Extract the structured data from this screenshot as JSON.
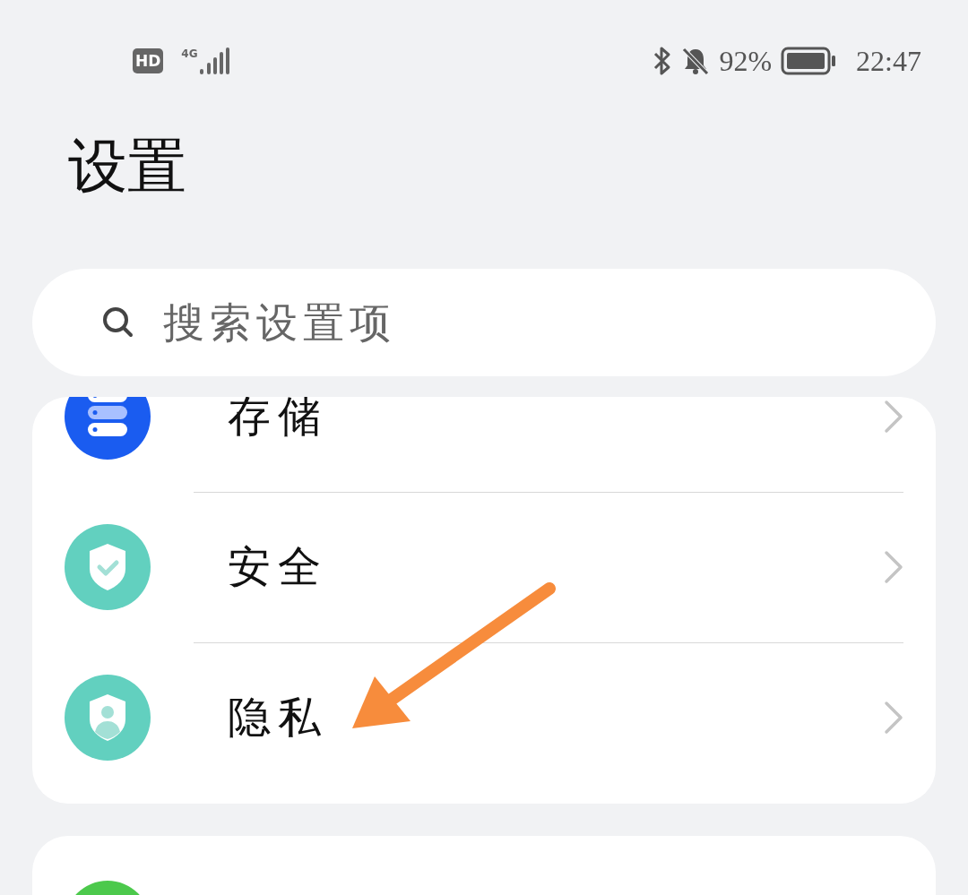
{
  "status_bar": {
    "hd": "HD",
    "network": "4G",
    "battery_text": "92%",
    "time": "22:47"
  },
  "title": "设置",
  "search": {
    "placeholder": "搜索设置项"
  },
  "groups": [
    {
      "items": [
        {
          "kind": "storage",
          "label": "存储"
        },
        {
          "kind": "security",
          "label": "安全"
        },
        {
          "kind": "privacy",
          "label": "隐私"
        }
      ]
    },
    {
      "items": [
        {
          "kind": "partial"
        }
      ]
    }
  ],
  "annotation": {
    "kind": "arrow"
  }
}
